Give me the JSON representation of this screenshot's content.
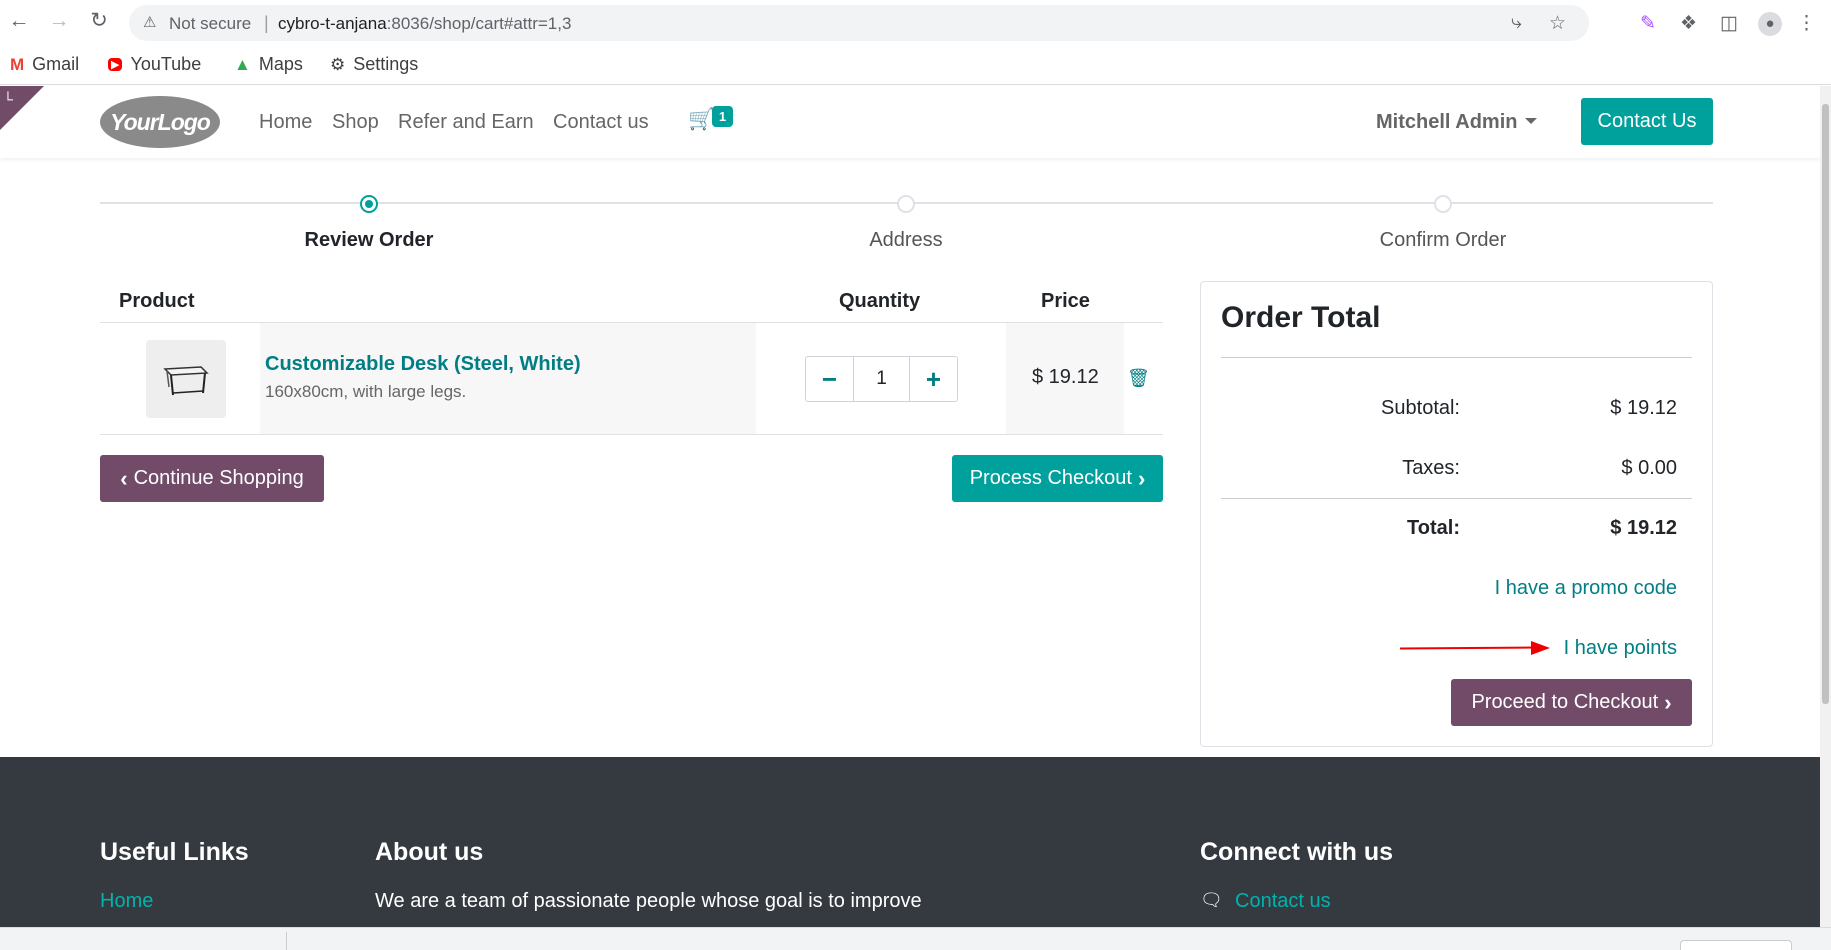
{
  "browser": {
    "security_label": "Not secure",
    "url_host": "cybro-t-anjana",
    "url_rest": ":8036/shop/cart#attr=1,3",
    "bookmarks": [
      {
        "label": "Gmail",
        "icon": "gmail-icon"
      },
      {
        "label": "YouTube",
        "icon": "youtube-icon"
      },
      {
        "label": "Maps",
        "icon": "maps-icon"
      },
      {
        "label": "Settings",
        "icon": "gear-icon"
      }
    ]
  },
  "header": {
    "logo_text": "YourLogo",
    "nav": [
      "Home",
      "Shop",
      "Refer and Earn",
      "Contact us"
    ],
    "cart_count": "1",
    "user_name": "Mitchell Admin",
    "contact_button": "Contact Us"
  },
  "steps": [
    {
      "label": "Review Order",
      "active": true
    },
    {
      "label": "Address",
      "active": false
    },
    {
      "label": "Confirm Order",
      "active": false
    }
  ],
  "cart": {
    "columns": {
      "product": "Product",
      "quantity": "Quantity",
      "price": "Price"
    },
    "items": [
      {
        "name": "Customizable Desk (Steel, White)",
        "description": "160x80cm, with large legs.",
        "quantity": "1",
        "price": "$ 19.12"
      }
    ],
    "continue_button": "Continue Shopping",
    "process_button": "Process Checkout"
  },
  "order_total": {
    "title": "Order Total",
    "subtotal_label": "Subtotal:",
    "subtotal_value": "$ 19.12",
    "taxes_label": "Taxes:",
    "taxes_value": "$ 0.00",
    "total_label": "Total:",
    "total_value": "$ 19.12",
    "promo_link": "I have a promo code",
    "points_link": "I have points",
    "checkout_button": "Proceed to Checkout"
  },
  "footer": {
    "useful_links_title": "Useful Links",
    "useful_links": [
      "Home"
    ],
    "about_title": "About us",
    "about_text": "We are a team of passionate people whose goal is to improve",
    "connect_title": "Connect with us",
    "connect_links": [
      "Contact us"
    ]
  },
  "colors": {
    "primary": "#00a09d",
    "secondary": "#714b67",
    "link": "#017e84",
    "footer_bg": "#343a40",
    "annotation_arrow": "#e00000"
  }
}
